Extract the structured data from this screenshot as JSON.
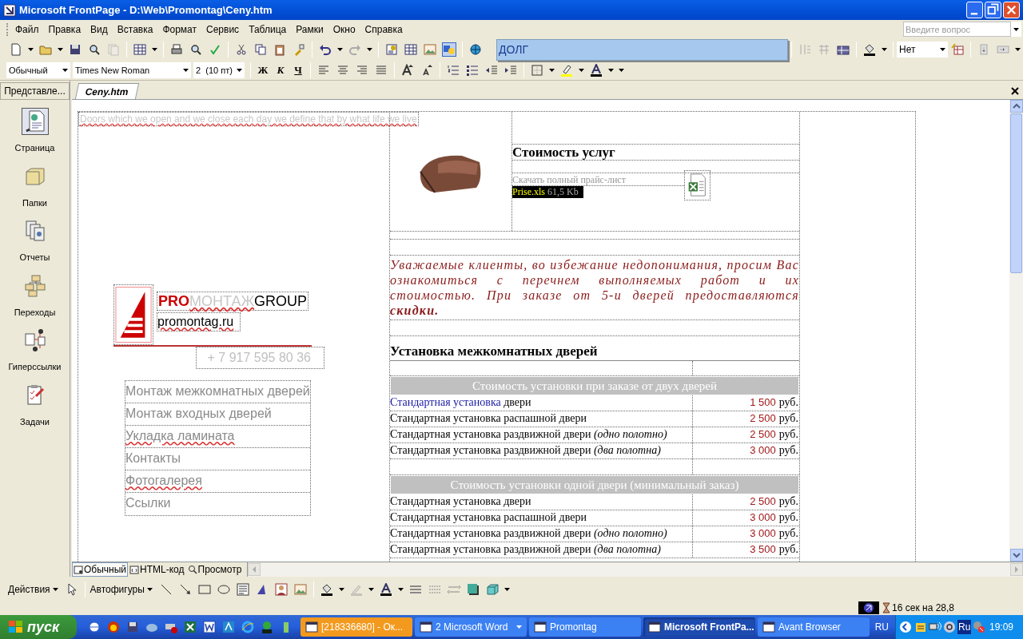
{
  "window": {
    "title": "Microsoft FrontPage - D:\\Web\\Promontag\\Ceny.htm"
  },
  "menu": [
    "Файл",
    "Правка",
    "Вид",
    "Вставка",
    "Формат",
    "Сервис",
    "Таблица",
    "Рамки",
    "Окно",
    "Справка"
  ],
  "help_box": {
    "placeholder": "Введите вопрос"
  },
  "autocomplete_popup": {
    "text": "ДОЛГ"
  },
  "table_toolbar": {
    "fill_value": "Нет"
  },
  "format_toolbar": {
    "style": "Обычный",
    "font": "Times New Roman",
    "size": "2  (10 пт)",
    "bold": "Ж",
    "italic": "К",
    "underline": "Ч"
  },
  "views_panel": {
    "title": "Представле...",
    "items": [
      {
        "kind": "page",
        "label": "Страница",
        "selected": true
      },
      {
        "kind": "folders",
        "label": "Папки",
        "selected": false
      },
      {
        "kind": "reports",
        "label": "Отчеты",
        "selected": false
      },
      {
        "kind": "navigation",
        "label": "Переходы",
        "selected": false
      },
      {
        "kind": "hyperlinks",
        "label": "Гиперссылки",
        "selected": false
      },
      {
        "kind": "tasks",
        "label": "Задачи",
        "selected": false
      }
    ]
  },
  "document_tab": {
    "label": "Ceny.htm"
  },
  "page": {
    "tagline": "Doors which we open and we close each day we define that by what life we live",
    "logo": {
      "pro": "PRO",
      "middle": "МОНТАЖ",
      "end": "GROUP",
      "site": "promontag.ru"
    },
    "phone": "+ 7 917 595 80 36",
    "nav": [
      {
        "label": "Монтаж межкомнатных дверей",
        "spell_error": false
      },
      {
        "label": "Монтаж входных дверей",
        "spell_error": false
      },
      {
        "label": "Укладка ламината",
        "spell_error": true
      },
      {
        "label": "Контакты",
        "spell_error": false
      },
      {
        "label": "Фотогалерея",
        "spell_error": true
      },
      {
        "label": "Ссылки",
        "spell_error": false
      }
    ],
    "heading": "Стоимость услуг",
    "download": {
      "label": "Скачать полный прайс-лист",
      "file": "Prise.xls",
      "size": "61,5 Kb"
    },
    "notice": "Уважаемые клиенты, во избежание недопонимания, просим Вас ознакомиться с перечнем выполняемых работ и их стоимостью. При заказе от 5-и дверей предоставляются **скидки.**",
    "section_title": "Установка межкомнатных дверей",
    "groups": [
      {
        "header": "Стоимость установки при заказе от двух дверей",
        "rows": [
          {
            "link": "Стандартная установка",
            "label": "двери",
            "price": "1 500",
            "currency": "руб."
          },
          {
            "label": "Стандартная установка распашной двери",
            "price": "2 500",
            "currency": "руб."
          },
          {
            "label": "Стандартная установка раздвижной двери *(одно полотно)*",
            "price": "2 500",
            "currency": "руб."
          },
          {
            "label": "Стандартная установка раздвижной двери *(два полотна)*",
            "price": "3 000",
            "currency": "руб."
          }
        ]
      },
      {
        "header": "Стоимость установки одной двери (минимальный заказ)",
        "rows": [
          {
            "label": "Стандартная установка двери",
            "price": "2 500",
            "currency": "руб."
          },
          {
            "label": "Стандартная установка распашной двери",
            "price": "3 000",
            "currency": "руб."
          },
          {
            "label": "Стандартная установка раздвижной двери *(одно полотно)*",
            "price": "3 000",
            "currency": "руб."
          },
          {
            "label": "Стандартная установка раздвижной двери *(два полотна)*",
            "price": "3 500",
            "currency": "руб."
          }
        ]
      }
    ]
  },
  "view_tabs": [
    {
      "label": "Обычный",
      "selected": true
    },
    {
      "label": "HTML-код",
      "selected": false
    },
    {
      "label": "Просмотр",
      "selected": false
    }
  ],
  "drawing_toolbar": {
    "actions": "Действия",
    "autoshapes": "Автофигуры"
  },
  "status_bar": {
    "download_time": "16 сек на 28,8"
  },
  "taskbar": {
    "start": "пуск",
    "tasks": [
      {
        "label": "[218336680] - Ок...",
        "selected": false,
        "flashing": true,
        "grouped": false
      },
      {
        "label": "2 Microsoft Word",
        "selected": false,
        "flashing": false,
        "grouped": true
      },
      {
        "label": "Promontag",
        "selected": false,
        "flashing": false,
        "grouped": false
      },
      {
        "label": "Microsoft FrontPa...",
        "selected": true,
        "flashing": false,
        "grouped": false
      },
      {
        "label": "Avant Browser",
        "selected": false,
        "flashing": false,
        "grouped": false
      }
    ],
    "language": "RU",
    "layout_indicator": "Ru",
    "clock": "19:09"
  }
}
